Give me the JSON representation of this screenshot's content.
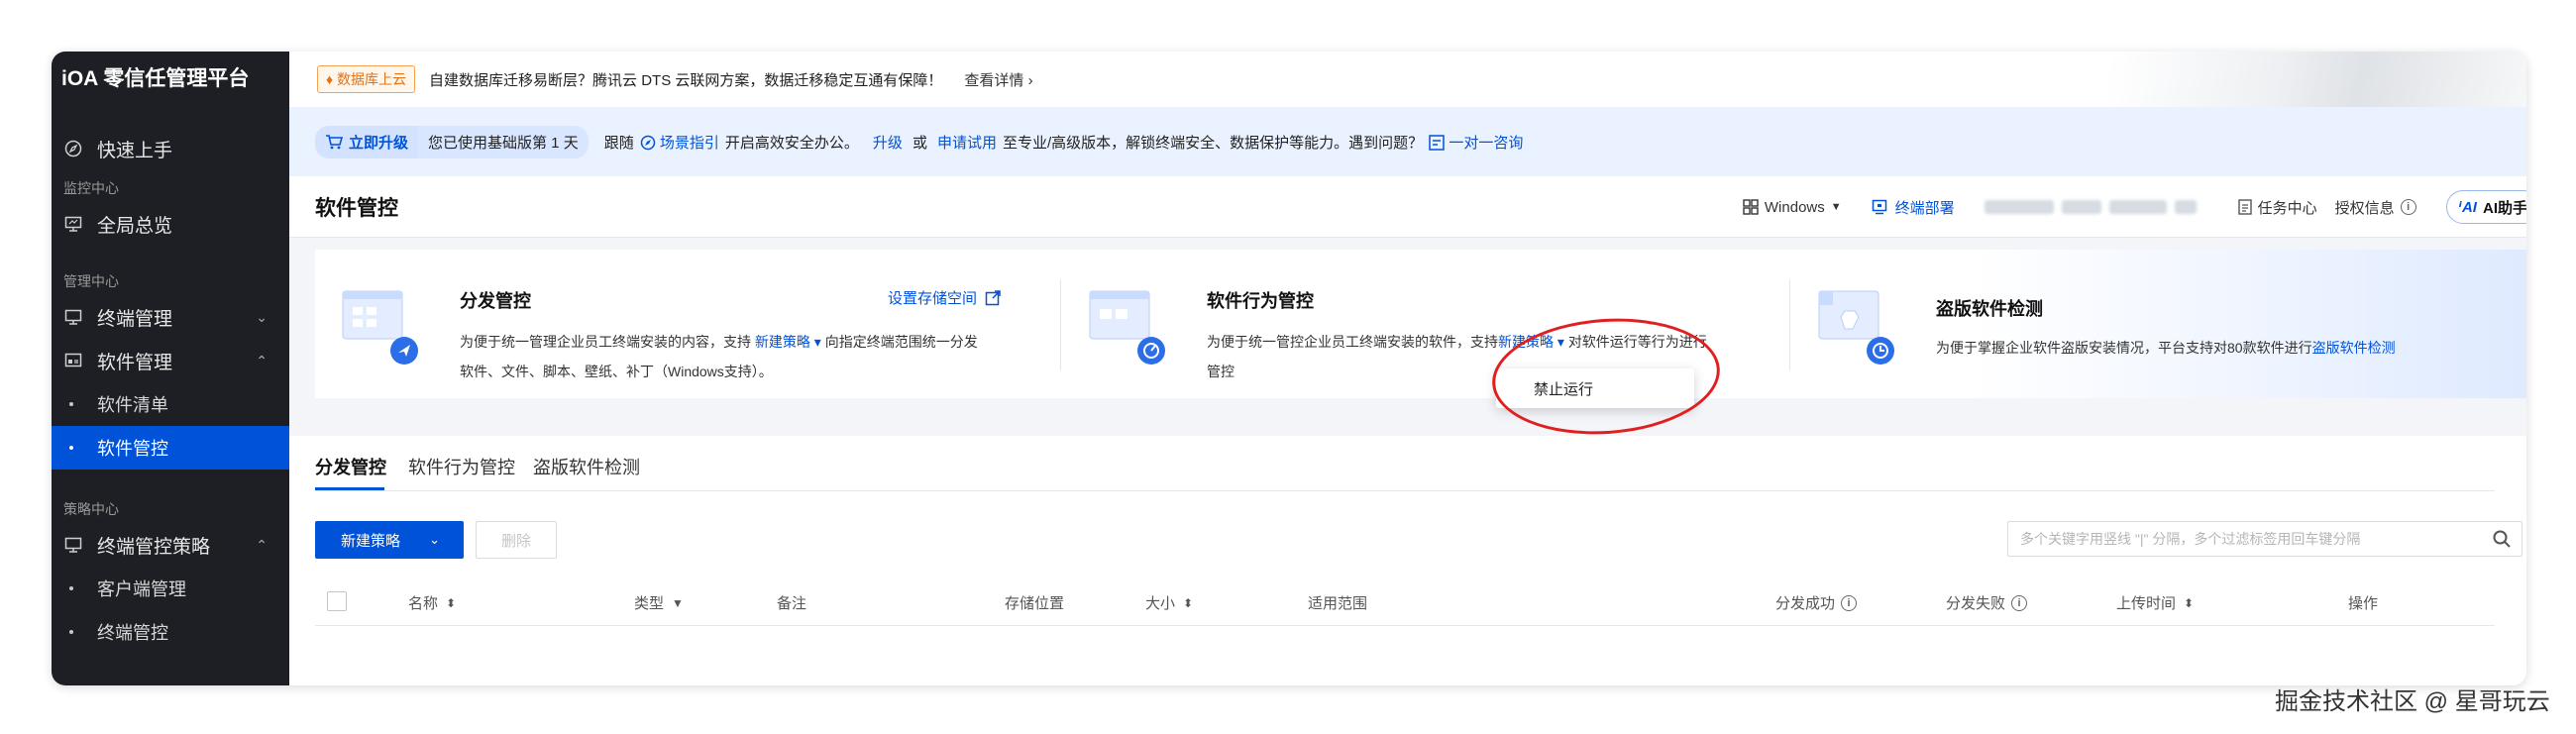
{
  "brand": {
    "title": "iOA 零信任管理平台"
  },
  "sidebar": {
    "quick_start": "快速上手",
    "groups": {
      "monitor": "监控中心",
      "manage": "管理中心",
      "policy": "策略中心"
    },
    "overview": "全局总览",
    "terminal_mgmt": "终端管理",
    "software_mgmt": "软件管理",
    "software_list": "软件清单",
    "software_control": "软件管控",
    "terminal_policy": "终端管控策略",
    "client_mgmt": "客户端管理",
    "terminal_control": "终端管控"
  },
  "notice": {
    "tag": "数据库上云",
    "text": "自建数据库迁移易断层？腾讯云 DTS 云联网方案，数据迁移稳定互通有保障！",
    "more": "查看详情"
  },
  "trial": {
    "upgrade": "立即升级",
    "days": "您已使用基础版第 1 天",
    "follow": "跟随",
    "guide": "场景指引",
    "tail1": "开启高效安全办公。",
    "upgrade_link": "升级",
    "or": "或",
    "apply_link": "申请试用",
    "tail2": "至专业/高级版本，解锁终端安全、数据保护等能力。遇到问题？",
    "consult": "一对一咨询"
  },
  "header": {
    "page_title": "软件管控",
    "os_select": "Windows",
    "deploy": "终端部署",
    "task_center": "任务中心",
    "license_info": "授权信息",
    "ai_assistant": "AI助手"
  },
  "cards": {
    "dist": {
      "title": "分发管控",
      "link": "设置存储空间",
      "desc1_a": "为便于统一管理企业员工终端安装的内容，支持",
      "desc1_link": "新建策略",
      "desc1_b": "向指定终端范围统一分发",
      "desc2": "软件、文件、脚本、壁纸、补丁（Windows支持）。"
    },
    "behavior": {
      "title": "软件行为管控",
      "desc1_a": "为便于统一管控企业员工终端安装的软件，支持",
      "desc1_link": "新建策略",
      "desc1_b": "对软件运行等行为进行",
      "desc2": "管控"
    },
    "piracy": {
      "title": "盗版软件检测",
      "desc_a": "为便于掌握企业软件盗版安装情况，平台支持对80款软件进行",
      "desc_link": "盗版软件检测"
    }
  },
  "dropdown": {
    "item": "禁止运行"
  },
  "tabs": [
    "分发管控",
    "软件行为管控",
    "盗版软件检测"
  ],
  "toolbar": {
    "new_policy": "新建策略",
    "delete": "删除",
    "search_placeholder": "多个关键字用竖线 \"|\" 分隔，多个过滤标签用回车键分隔"
  },
  "table": {
    "headers": [
      "名称",
      "类型",
      "备注",
      "存储位置",
      "大小",
      "适用范围",
      "分发成功",
      "分发失败",
      "上传时间",
      "操作"
    ]
  },
  "watermark": "掘金技术社区 @ 星哥玩云",
  "colors": {
    "primary": "#0052d9",
    "sidebar_bg": "#1d1f24",
    "annotation": "#e02020"
  }
}
